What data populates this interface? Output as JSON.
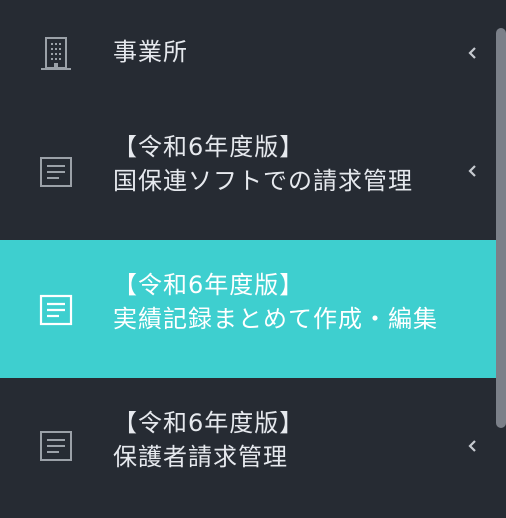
{
  "menu": {
    "items": [
      {
        "label_lines": [
          "事業所"
        ],
        "icon": "building-icon",
        "active": false,
        "has_chevron": true
      },
      {
        "label_lines": [
          "【令和6年度版】",
          "国保連ソフトでの請求管理"
        ],
        "icon": "document-icon",
        "active": false,
        "has_chevron": true
      },
      {
        "label_lines": [
          "【令和6年度版】",
          "実績記録まとめて作成・編集"
        ],
        "icon": "document-icon",
        "active": true,
        "has_chevron": false
      },
      {
        "label_lines": [
          "【令和6年度版】",
          "保護者請求管理"
        ],
        "icon": "document-icon",
        "active": false,
        "has_chevron": true
      }
    ]
  },
  "colors": {
    "background": "#262b33",
    "active_background": "#3ecfcf",
    "text": "#e6e9ee",
    "icon": "#9ba1a8",
    "scrollbar": "#7b8089"
  }
}
